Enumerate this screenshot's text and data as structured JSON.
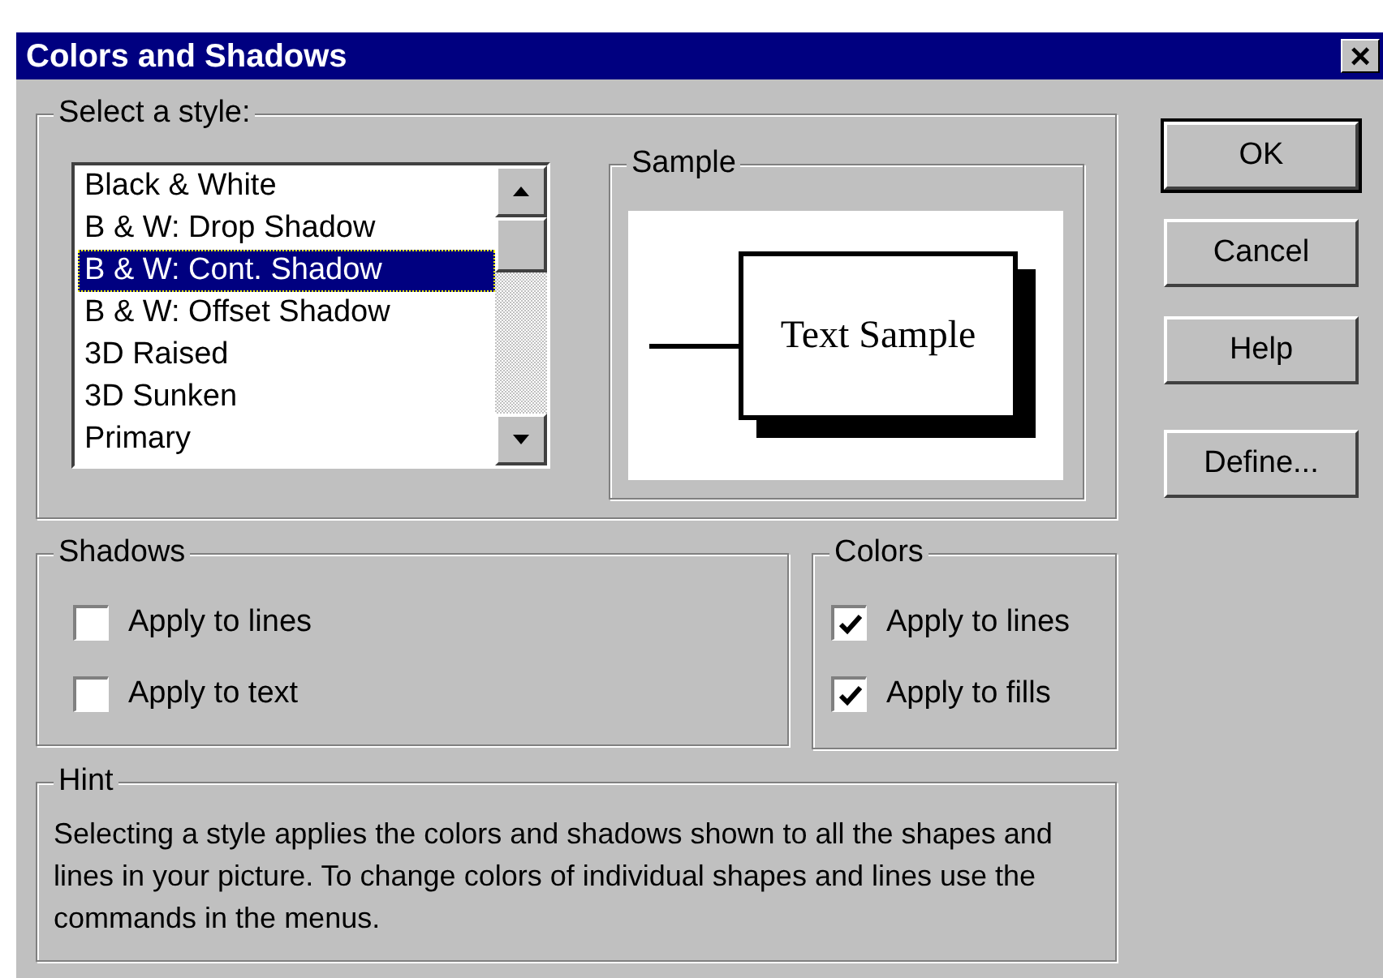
{
  "window": {
    "title": "Colors and Shadows",
    "close": "×"
  },
  "style_group": {
    "label": "Select a style:",
    "items": [
      {
        "label": "Black & White",
        "selected": false
      },
      {
        "label": "B & W: Drop Shadow",
        "selected": false
      },
      {
        "label": "B & W: Cont. Shadow",
        "selected": true
      },
      {
        "label": "B & W: Offset Shadow",
        "selected": false
      },
      {
        "label": "3D Raised",
        "selected": false
      },
      {
        "label": "3D Sunken",
        "selected": false
      },
      {
        "label": "Primary",
        "selected": false
      }
    ]
  },
  "sample": {
    "label": "Sample",
    "text": "Text Sample"
  },
  "buttons": [
    {
      "label": "OK",
      "default": true
    },
    {
      "label": "Cancel",
      "default": false
    },
    {
      "label": "Help",
      "default": false
    },
    {
      "label": "Define...",
      "default": false
    }
  ],
  "shadows": {
    "label": "Shadows",
    "options": [
      {
        "label": "Apply to lines",
        "checked": false
      },
      {
        "label": "Apply to text",
        "checked": false
      }
    ]
  },
  "colors": {
    "label": "Colors",
    "options": [
      {
        "label": "Apply to lines",
        "checked": true
      },
      {
        "label": "Apply to fills",
        "checked": true
      }
    ]
  },
  "hint": {
    "label": "Hint",
    "text": "Selecting a style applies the colors and shadows shown to all the shapes and lines in your picture. To change colors of individual shapes and lines use the commands in the menus."
  }
}
